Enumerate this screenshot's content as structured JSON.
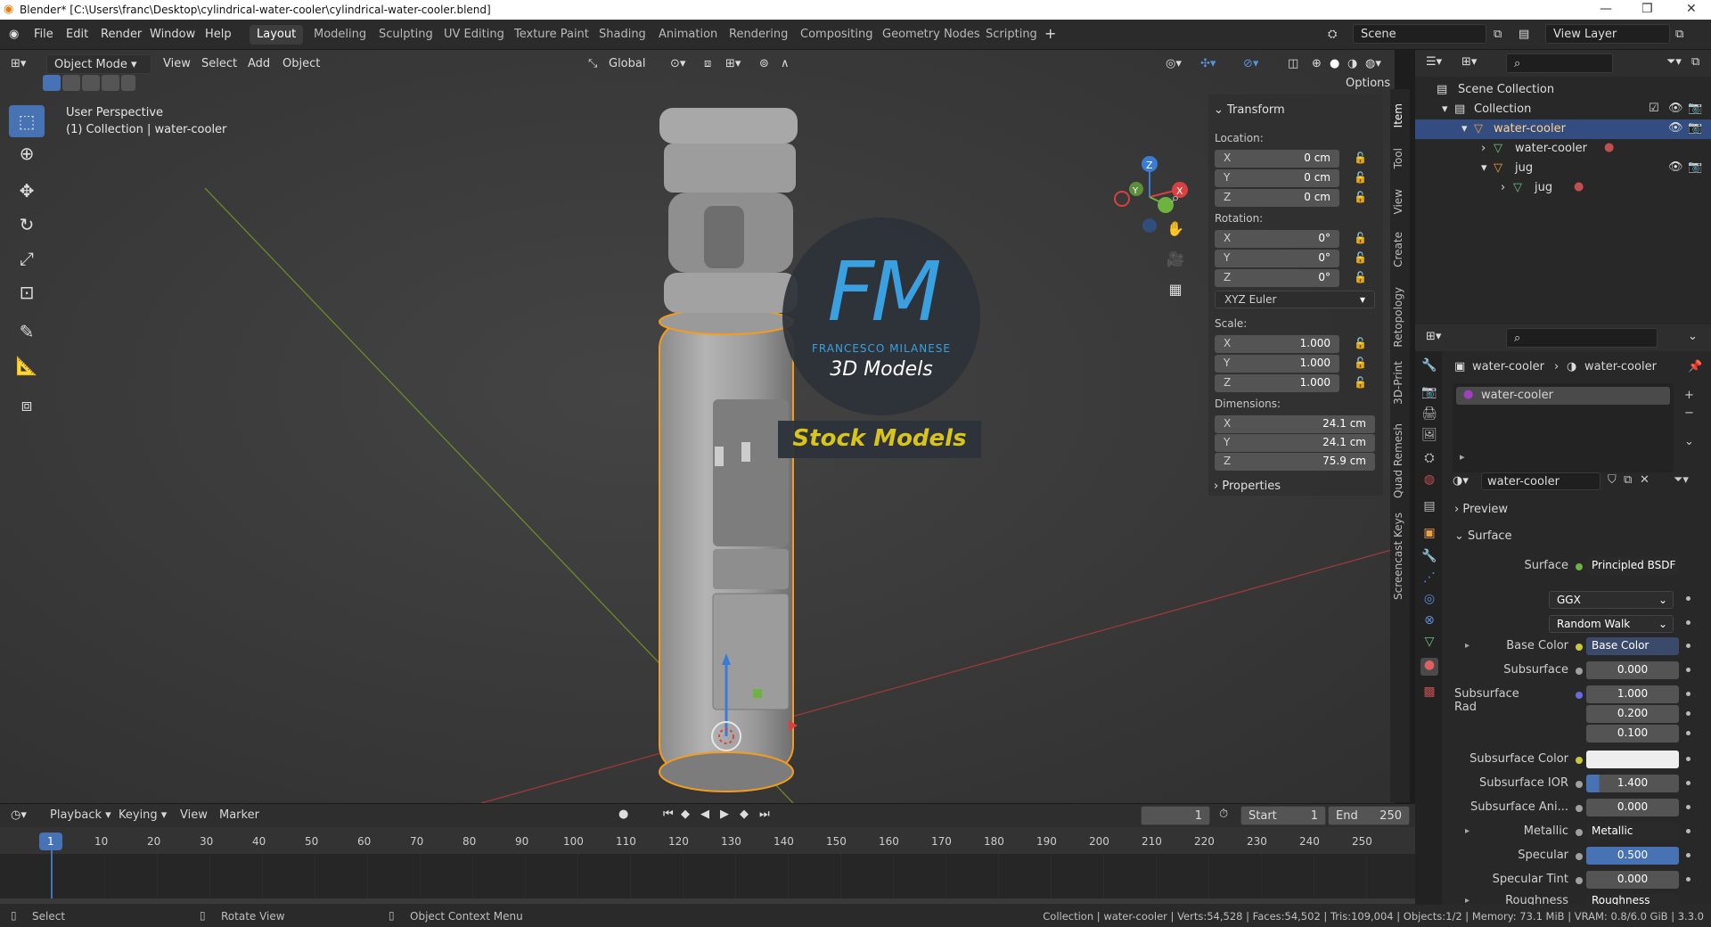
{
  "window": {
    "title": "Blender* [C:\\Users\\franc\\Desktop\\cylindrical-water-cooler\\cylindrical-water-cooler.blend]"
  },
  "menu": {
    "items": [
      "File",
      "Edit",
      "Render",
      "Window",
      "Help"
    ]
  },
  "workspaces": [
    "Layout",
    "Modeling",
    "Sculpting",
    "UV Editing",
    "Texture Paint",
    "Shading",
    "Animation",
    "Rendering",
    "Compositing",
    "Geometry Nodes",
    "Scripting"
  ],
  "scene": {
    "scene_label": "Scene",
    "view_layer_label": "View Layer"
  },
  "viewport_header": {
    "mode": "Object Mode",
    "menus": [
      "View",
      "Select",
      "Add",
      "Object"
    ],
    "orientation": "Global",
    "options": "Options"
  },
  "viewport": {
    "perspective": "User Perspective",
    "collection": "(1) Collection | water-cooler"
  },
  "watermark": {
    "logo": "FM",
    "name": "FRANCESCO MILANESE",
    "sub": "3D Models",
    "banner": "Stock Models"
  },
  "npanel": {
    "transform": "Transform",
    "location_label": "Location:",
    "location": [
      {
        "axis": "X",
        "value": "0 cm"
      },
      {
        "axis": "Y",
        "value": "0 cm"
      },
      {
        "axis": "Z",
        "value": "0 cm"
      }
    ],
    "rotation_label": "Rotation:",
    "rotation": [
      {
        "axis": "X",
        "value": "0°"
      },
      {
        "axis": "Y",
        "value": "0°"
      },
      {
        "axis": "Z",
        "value": "0°"
      }
    ],
    "rotation_mode": "XYZ Euler",
    "scale_label": "Scale:",
    "scale": [
      {
        "axis": "X",
        "value": "1.000"
      },
      {
        "axis": "Y",
        "value": "1.000"
      },
      {
        "axis": "Z",
        "value": "1.000"
      }
    ],
    "dimensions_label": "Dimensions:",
    "dimensions": [
      {
        "axis": "X",
        "value": "24.1 cm"
      },
      {
        "axis": "Y",
        "value": "24.1 cm"
      },
      {
        "axis": "Z",
        "value": "75.9 cm"
      }
    ],
    "properties": "Properties"
  },
  "side_tabs": [
    "Item",
    "Tool",
    "View",
    "Create",
    "Retopology",
    "3D-Print",
    "Quad Remesh",
    "Screencast Keys"
  ],
  "outliner": {
    "rows": [
      {
        "label": "Scene Collection"
      },
      {
        "label": "Collection"
      },
      {
        "label": "water-cooler"
      },
      {
        "label": "water-cooler"
      },
      {
        "label": "jug"
      },
      {
        "label": "jug"
      }
    ]
  },
  "properties": {
    "breadcrumb_obj": "water-cooler",
    "breadcrumb_mat": "water-cooler",
    "slot": "water-cooler",
    "material_name": "water-cooler",
    "preview": "Preview",
    "surface_section": "Surface",
    "surface_label": "Surface",
    "surface_value": "Principled BSDF",
    "distribution": "GGX",
    "subsurface_method": "Random Walk",
    "rows": [
      {
        "label": "Base Color",
        "value": "Base Color"
      },
      {
        "label": "Subsurface",
        "value": "0.000"
      },
      {
        "label": "Subsurface Rad",
        "value": "1.000"
      },
      {
        "label": "",
        "value": "0.200"
      },
      {
        "label": "",
        "value": "0.100"
      },
      {
        "label": "Subsurface Color",
        "value": ""
      },
      {
        "label": "Subsurface IOR",
        "value": "1.400"
      },
      {
        "label": "Subsurface Ani...",
        "value": "0.000"
      },
      {
        "label": "Metallic",
        "value": "Metallic"
      },
      {
        "label": "Specular",
        "value": "0.500"
      },
      {
        "label": "Specular Tint",
        "value": "0.000"
      },
      {
        "label": "Roughness",
        "value": "Roughness"
      }
    ]
  },
  "timeline": {
    "menus": [
      "Playback",
      "Keying",
      "View",
      "Marker"
    ],
    "current_frame": "1",
    "start_label": "Start",
    "start": "1",
    "end_label": "End",
    "end": "250",
    "ticks": [
      "1",
      "10",
      "20",
      "30",
      "40",
      "50",
      "60",
      "70",
      "80",
      "90",
      "100",
      "110",
      "120",
      "130",
      "140",
      "150",
      "160",
      "170",
      "180",
      "190",
      "200",
      "210",
      "220",
      "230",
      "240",
      "250"
    ]
  },
  "statusbar": {
    "select": "Select",
    "rotate": "Rotate View",
    "context": "Object Context Menu",
    "stats": "Collection | water-cooler | Verts:54,528 | Faces:54,502 | Tris:109,004 | Objects:1/2 | Memory: 73.1 MiB | VRAM: 0.8/6.0 GiB | 3.3.0"
  }
}
